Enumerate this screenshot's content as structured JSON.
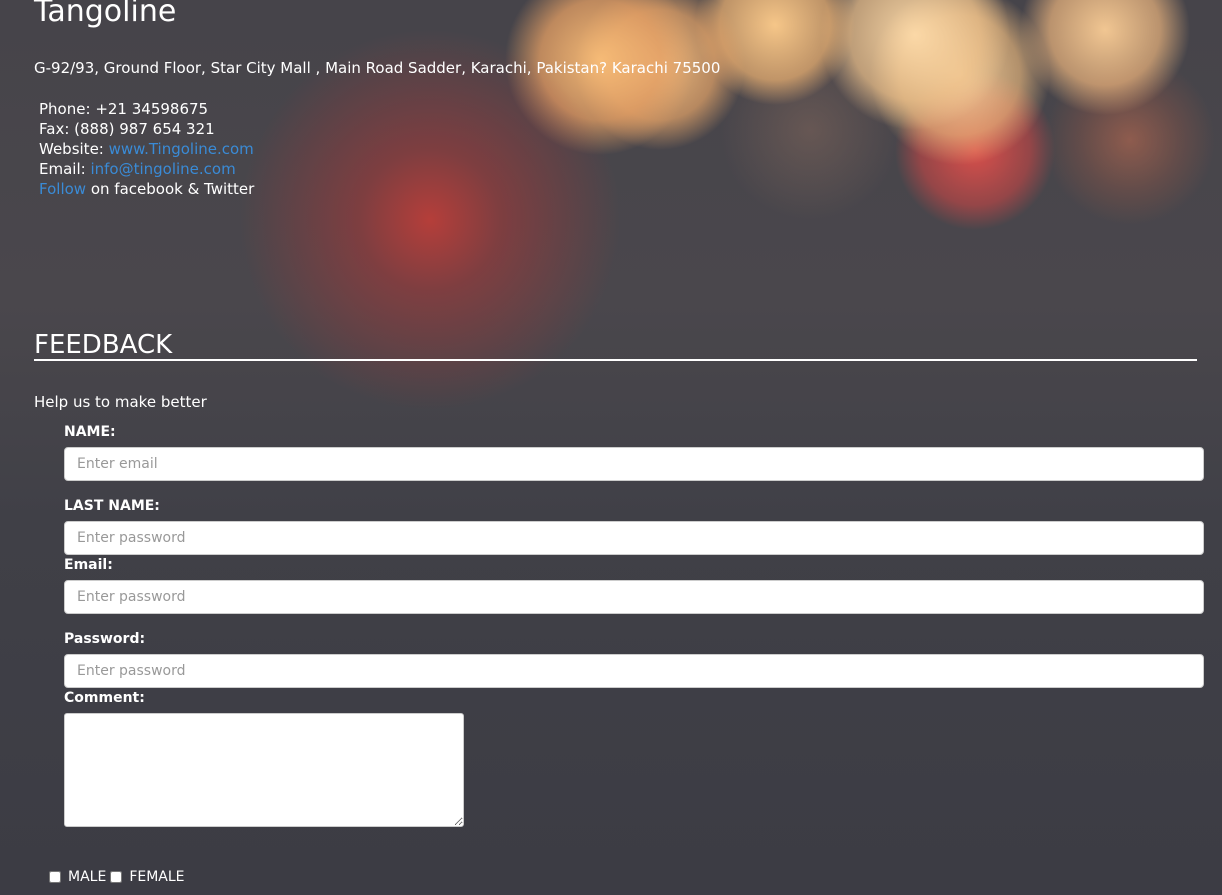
{
  "header": {
    "brand": "Tangoline",
    "address": "G-92/93, Ground Floor, Star City Mall , Main Road Sadder, Karachi, Pakistan? Karachi 75500"
  },
  "contact": {
    "phone_label": "Phone:",
    "phone": "+21 34598675",
    "fax_label": "Fax:",
    "fax": "(888) 987 654 321",
    "website_label": "Website:",
    "website": "www.Tingoline.com",
    "email_label": "Email:",
    "email": "info@tingoline.com",
    "follow_link": "Follow",
    "follow_text": "on facebook & Twitter"
  },
  "feedback": {
    "title": "FEEDBACK",
    "subtitle": "Help us to make better",
    "fields": {
      "name_label": "NAME:",
      "name_placeholder": "Enter email",
      "last_name_label": "LAST NAME:",
      "last_name_placeholder": "Enter password",
      "email_label": "Email:",
      "email_placeholder": "Enter password",
      "password_label": "Password:",
      "password_placeholder": "Enter password",
      "comment_label": "Comment:"
    },
    "gender": {
      "male": "MALE",
      "female": "FEMALE",
      "male_checked": false,
      "female_checked": false
    }
  },
  "colors": {
    "link": "#3a8bd6",
    "background": "#3c3c44",
    "text": "#ffffff"
  }
}
